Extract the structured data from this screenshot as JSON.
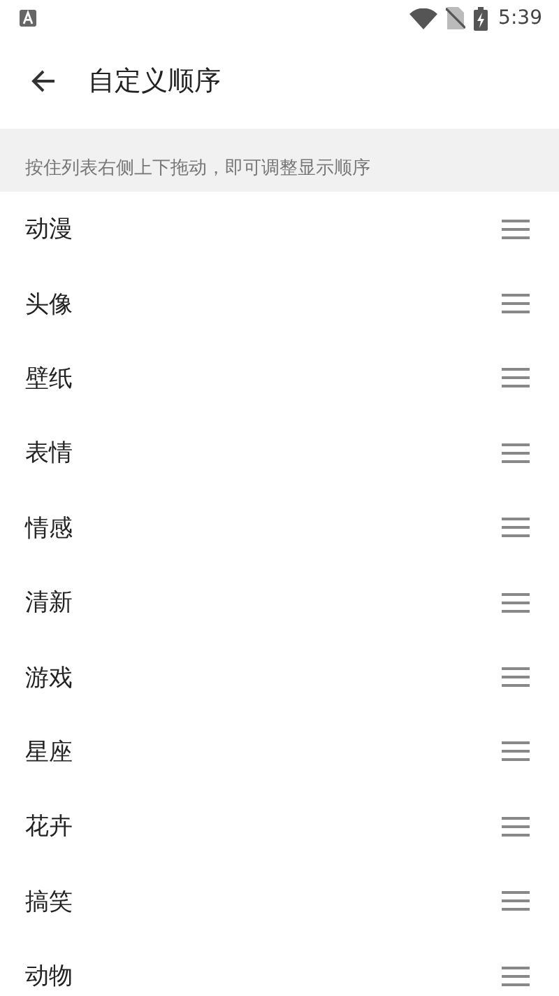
{
  "status_bar": {
    "time": "5:39"
  },
  "header": {
    "title": "自定义顺序"
  },
  "hint": "按住列表右侧上下拖动，即可调整显示顺序",
  "items": [
    {
      "label": "动漫"
    },
    {
      "label": "头像"
    },
    {
      "label": "壁纸"
    },
    {
      "label": "表情"
    },
    {
      "label": "情感"
    },
    {
      "label": "清新"
    },
    {
      "label": "游戏"
    },
    {
      "label": "星座"
    },
    {
      "label": "花卉"
    },
    {
      "label": "搞笑"
    },
    {
      "label": "动物"
    }
  ]
}
